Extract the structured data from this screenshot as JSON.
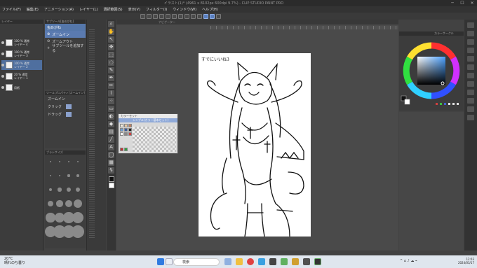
{
  "window": {
    "title": "イラスト(1)* (4961 x 8102px 600dpi 9.7%) - CLIP STUDIO PAINT PRO",
    "minimize": "─",
    "maximize": "☐",
    "close": "✕"
  },
  "menu": [
    "ファイル(F)",
    "編集(E)",
    "アニメーション(A)",
    "レイヤー(L)",
    "選択範囲(S)",
    "表示(V)",
    "フィルター(I)",
    "ウィンドウ(W)",
    "ヘルプ(H)"
  ],
  "layers_panel": {
    "header": "レイヤー",
    "layers": [
      {
        "opacity": "100 % 通常",
        "name": "レイヤー 4",
        "selected": false
      },
      {
        "opacity": "100 % 通常",
        "name": "レイヤー 3",
        "selected": false
      },
      {
        "opacity": "100 % 通常",
        "name": "レイヤー 2",
        "selected": true
      },
      {
        "opacity": "20 % 通常",
        "name": "レイヤー 1",
        "selected": false
      },
      {
        "opacity": "",
        "name": "用紙",
        "selected": false
      }
    ]
  },
  "subtool_panel": {
    "header": "サブツール[虫めがね]",
    "tab": "虫めがね",
    "items": [
      "ズームイン",
      "ズームアウト",
      "サブツールを追加する"
    ]
  },
  "tool_property": {
    "header": "ツールプロパティ[ズームイン]",
    "title": "ズームイン",
    "rows": [
      {
        "label": "クリック",
        "value": ""
      },
      {
        "label": "ドラッグ",
        "value": ""
      }
    ]
  },
  "brush_size": {
    "header": "ブラシサイズ"
  },
  "navigator": {
    "header": "ナビゲーター"
  },
  "canvas": {
    "note": "すでにいいね3"
  },
  "color_set": {
    "header": "カラーセット",
    "preset": "シンプル(カラー基本セット)"
  },
  "color_circle": {
    "header": "カラーサークル"
  },
  "taskbar": {
    "weather_temp": "20°C",
    "weather_text": "晴れのち曇り",
    "search_placeholder": "検索",
    "time": "12:03",
    "date": "2024/03/17"
  },
  "colors": {
    "accent": "#5a7fbf",
    "selected_layer": "#4f6f9f",
    "foreground": "#111111",
    "background": "#ffffff"
  }
}
